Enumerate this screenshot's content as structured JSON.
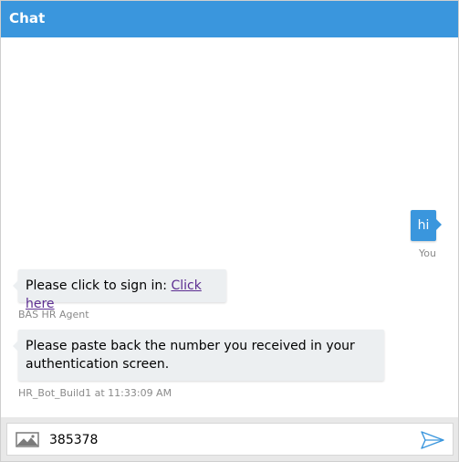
{
  "header": {
    "title": "Chat"
  },
  "messages": {
    "user": {
      "text": "hi",
      "sender": "You"
    },
    "bot1": {
      "text_prefix": "Please click to sign in: ",
      "link_text": "Click here",
      "sender": "BAS HR Agent"
    },
    "bot2": {
      "text": "Please paste back the number you received in your authentication screen.",
      "meta": "HR_Bot_Build1 at 11:33:09 AM"
    }
  },
  "composer": {
    "value": "385378"
  },
  "colors": {
    "accent": "#3a96dd",
    "bot_bubble": "#eceff1",
    "link": "#5c2d91"
  },
  "icons": {
    "upload": "image-icon",
    "send": "send-icon"
  }
}
